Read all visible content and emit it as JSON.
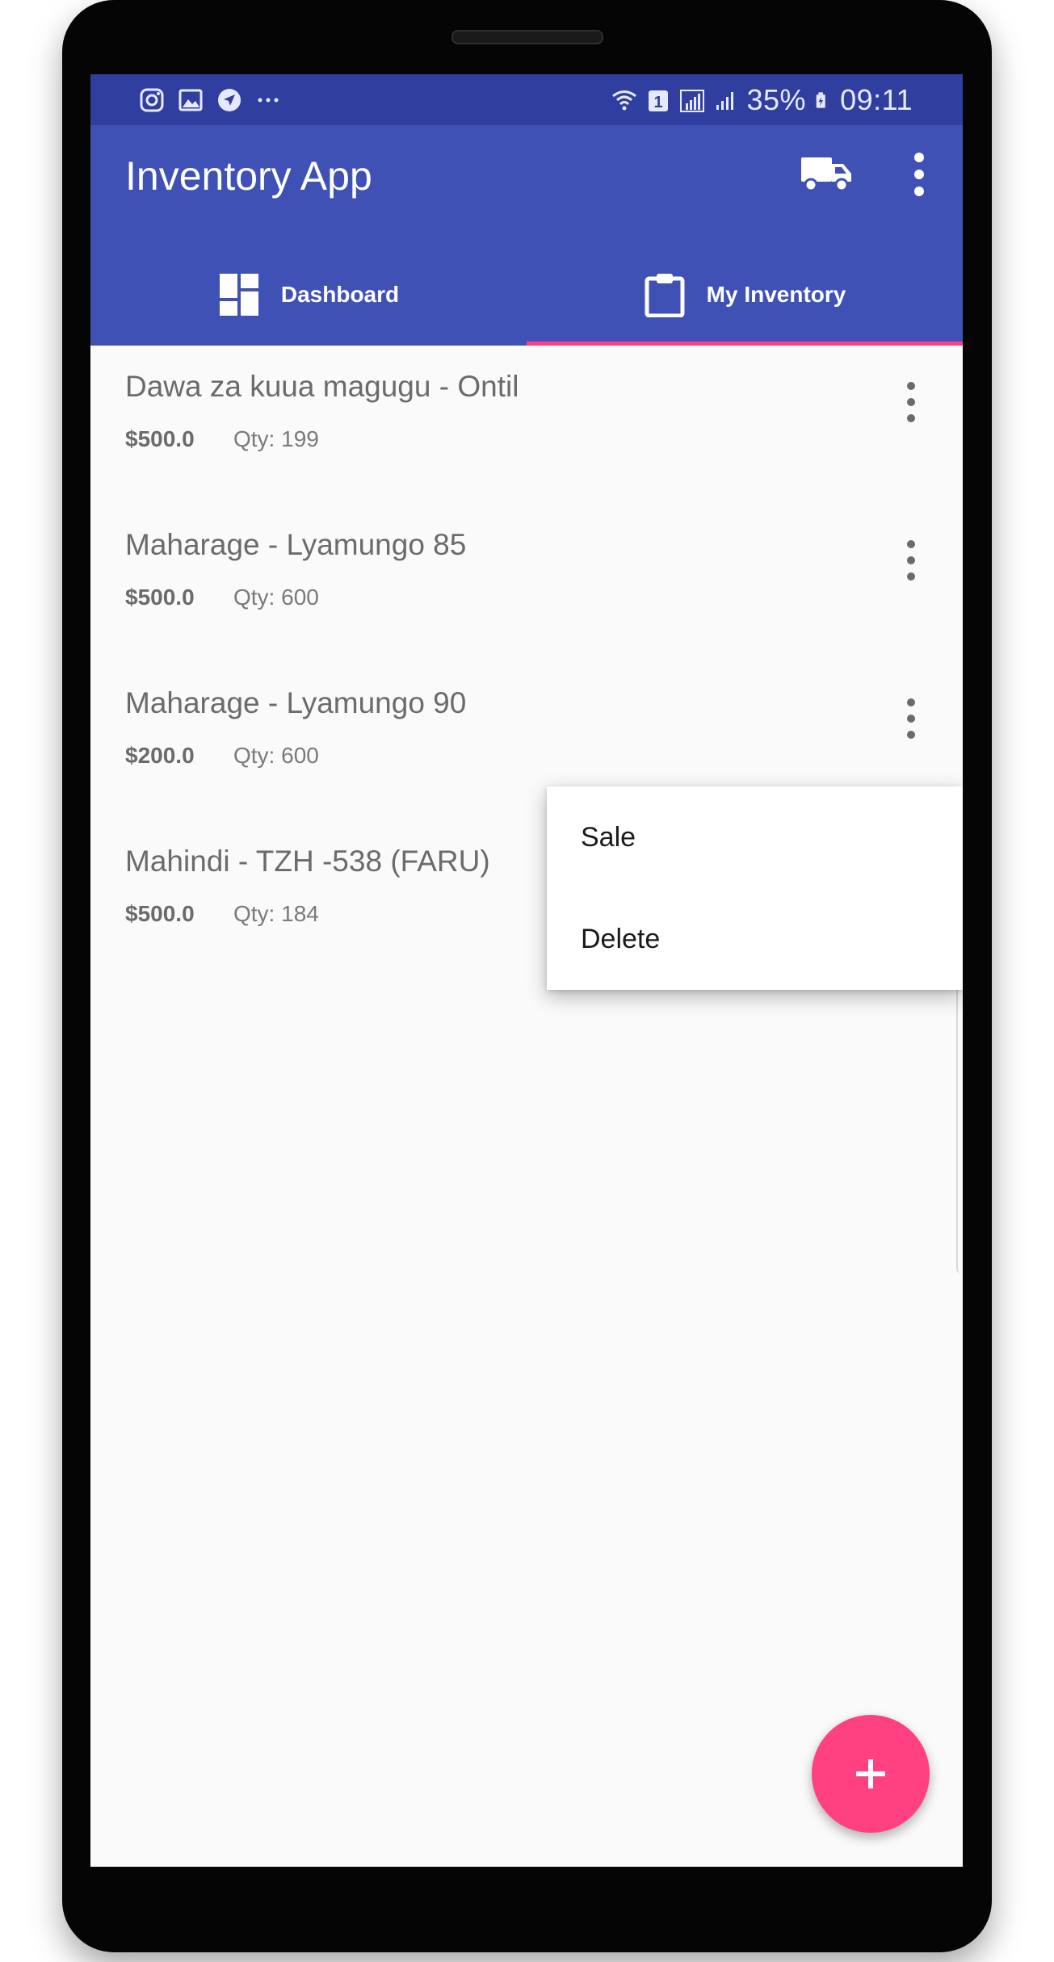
{
  "status_bar": {
    "left_icons": [
      "instagram-icon",
      "gallery-icon",
      "navigation-icon",
      "more-notifications-icon"
    ],
    "right_icons": [
      "wifi-icon",
      "sim-1-icon",
      "signal-1-icon",
      "signal-2-icon",
      "battery-charging-icon"
    ],
    "battery": "35%",
    "time": "09:11"
  },
  "app_bar": {
    "title": "Inventory App",
    "actions": [
      "truck-icon",
      "more-vert-icon"
    ]
  },
  "tabs": [
    {
      "label": "Dashboard",
      "icon": "dashboard-icon",
      "selected": false
    },
    {
      "label": "My Inventory",
      "icon": "clipboard-icon",
      "selected": true
    }
  ],
  "inventory": {
    "items": [
      {
        "name": "Dawa za kuua magugu - Ontil",
        "price": "$500.0",
        "qty": "Qty: 199"
      },
      {
        "name": "Maharage - Lyamungo 85",
        "price": "$500.0",
        "qty": "Qty: 600"
      },
      {
        "name": "Maharage - Lyamungo 90",
        "price": "$200.0",
        "qty": "Qty: 600"
      },
      {
        "name": "Mahindi - TZH -538 (FARU)",
        "price": "$500.0",
        "qty": "Qty: 184"
      }
    ]
  },
  "popup_menu": {
    "items": [
      "Sale",
      "Delete"
    ]
  },
  "fab": {
    "icon": "add-icon"
  },
  "colors": {
    "primary": "#3f51b5",
    "primary_dark": "#303f9f",
    "accent": "#ff4081",
    "background": "#fafafa",
    "text_secondary": "#6b6b6b"
  }
}
